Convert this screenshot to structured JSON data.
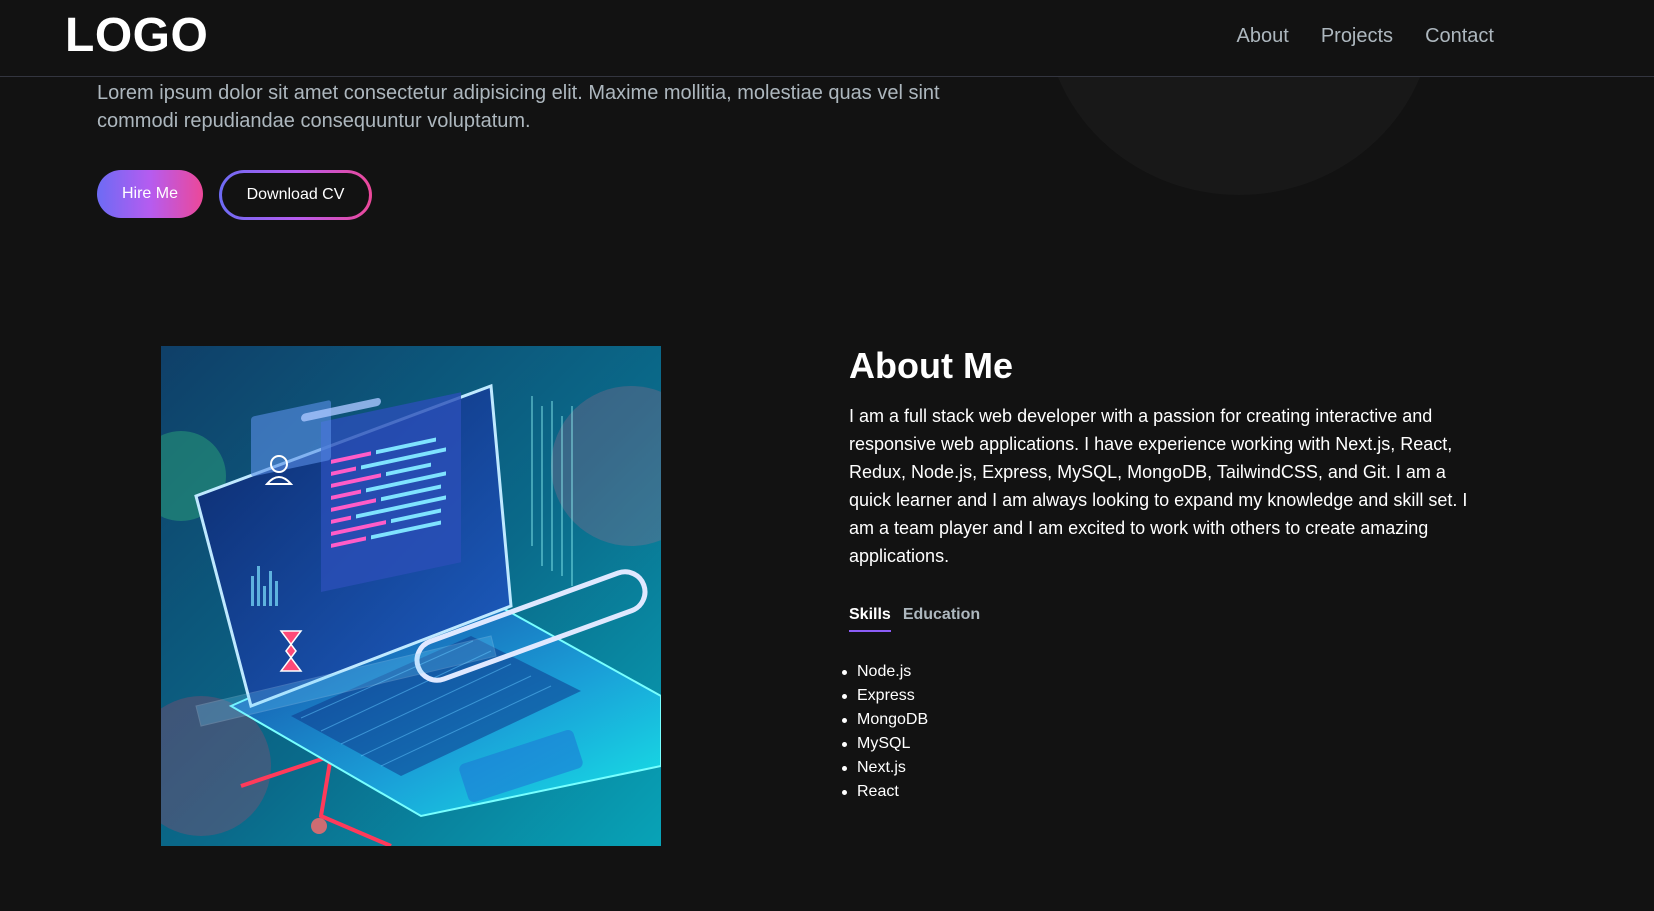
{
  "navbar": {
    "logo": "LOGO",
    "links": [
      {
        "label": "About"
      },
      {
        "label": "Projects"
      },
      {
        "label": "Contact"
      }
    ]
  },
  "hero": {
    "description": "Lorem ipsum dolor sit amet consectetur adipisicing elit. Maxime mollitia, molestiae quas vel sint commodi repudiandae consequuntur voluptatum.",
    "hire_label": "Hire Me",
    "cv_label": "Download CV"
  },
  "about": {
    "title": "About Me",
    "text": "I am a full stack web developer with a passion for creating interactive and responsive web applications. I have experience working with Next.js, React, Redux, Node.js, Express, MySQL, MongoDB, TailwindCSS, and Git. I am a quick learner and I am always looking to expand my knowledge and skill set. I am a team player and I am excited to work with others to create amazing applications.",
    "tabs": [
      {
        "label": "Skills",
        "active": true
      },
      {
        "label": "Education",
        "active": false
      }
    ],
    "skills": [
      "Node.js",
      "Express",
      "MongoDB",
      "MySQL",
      "Next.js",
      "React"
    ]
  },
  "colors": {
    "background": "#121212",
    "accent_start": "#6d6bf4",
    "accent_mid": "#b55cf0",
    "accent_end": "#ec4899",
    "muted_text": "#adb7be"
  }
}
